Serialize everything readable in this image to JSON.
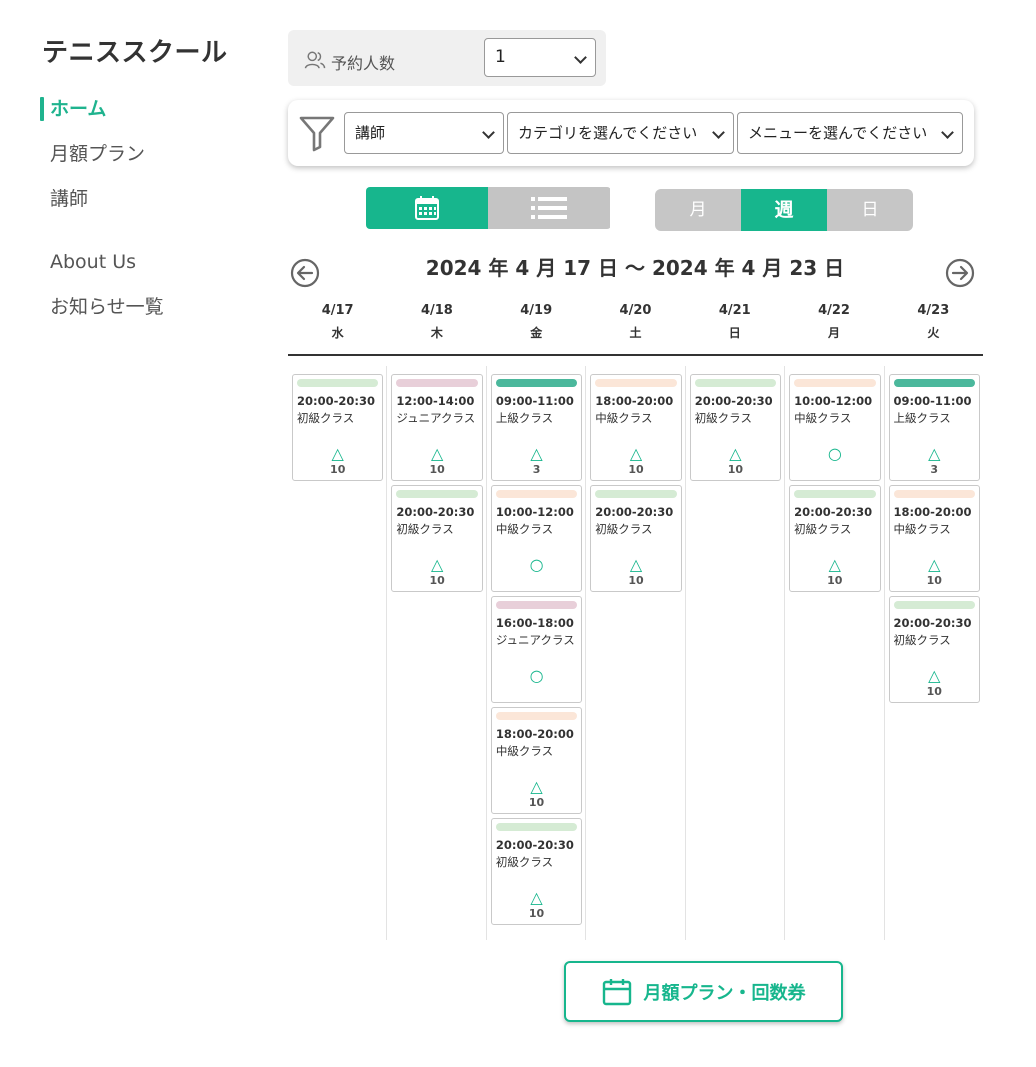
{
  "brand": "テニススクール",
  "nav": [
    {
      "label": "ホーム",
      "active": true
    },
    {
      "label": "月額プラン"
    },
    {
      "label": "講師"
    },
    {
      "label": "About Us"
    },
    {
      "label": "お知らせ一覧"
    }
  ],
  "people": {
    "label": "予約人数",
    "value": "1"
  },
  "filters": {
    "instructor": "講師",
    "category": "カテゴリを選んでください",
    "menu": "メニューを選んでください"
  },
  "view_toggle": {
    "active": "calendar"
  },
  "period": {
    "month": "月",
    "week": "週",
    "day": "日",
    "active": "week"
  },
  "week_title": "2024 年 4 月 17 日 〜 2024 年 4 月 23 日",
  "colors": {
    "accent": "#17b68d",
    "beginner": "#d5ebd4",
    "junior": "#e8cfd9",
    "advanced": "#4bb89c",
    "intermediate": "#fbe6d8"
  },
  "days": [
    {
      "date": "4/17",
      "weekday": "水",
      "slots": [
        {
          "time": "20:00-20:30",
          "class": "初級クラス",
          "level": "beginner",
          "mark": "△",
          "count": "10"
        }
      ]
    },
    {
      "date": "4/18",
      "weekday": "木",
      "slots": [
        {
          "time": "12:00-14:00",
          "class": "ジュニアクラス",
          "level": "junior",
          "mark": "△",
          "count": "10"
        },
        {
          "time": "20:00-20:30",
          "class": "初級クラス",
          "level": "beginner",
          "mark": "△",
          "count": "10"
        }
      ]
    },
    {
      "date": "4/19",
      "weekday": "金",
      "slots": [
        {
          "time": "09:00-11:00",
          "class": "上級クラス",
          "level": "advanced",
          "mark": "△",
          "count": "3"
        },
        {
          "time": "10:00-12:00",
          "class": "中級クラス",
          "level": "intermediate",
          "mark": "○",
          "count": ""
        },
        {
          "time": "16:00-18:00",
          "class": "ジュニアクラス",
          "level": "junior",
          "mark": "○",
          "count": ""
        },
        {
          "time": "18:00-20:00",
          "class": "中級クラス",
          "level": "intermediate",
          "mark": "△",
          "count": "10"
        },
        {
          "time": "20:00-20:30",
          "class": "初級クラス",
          "level": "beginner",
          "mark": "△",
          "count": "10"
        }
      ]
    },
    {
      "date": "4/20",
      "weekday": "土",
      "slots": [
        {
          "time": "18:00-20:00",
          "class": "中級クラス",
          "level": "intermediate",
          "mark": "△",
          "count": "10"
        },
        {
          "time": "20:00-20:30",
          "class": "初級クラス",
          "level": "beginner",
          "mark": "△",
          "count": "10"
        }
      ]
    },
    {
      "date": "4/21",
      "weekday": "日",
      "slots": [
        {
          "time": "20:00-20:30",
          "class": "初級クラス",
          "level": "beginner",
          "mark": "△",
          "count": "10"
        }
      ]
    },
    {
      "date": "4/22",
      "weekday": "月",
      "slots": [
        {
          "time": "10:00-12:00",
          "class": "中級クラス",
          "level": "intermediate",
          "mark": "○",
          "count": ""
        },
        {
          "time": "20:00-20:30",
          "class": "初級クラス",
          "level": "beginner",
          "mark": "△",
          "count": "10"
        }
      ]
    },
    {
      "date": "4/23",
      "weekday": "火",
      "slots": [
        {
          "time": "09:00-11:00",
          "class": "上級クラス",
          "level": "advanced",
          "mark": "△",
          "count": "3"
        },
        {
          "time": "18:00-20:00",
          "class": "中級クラス",
          "level": "intermediate",
          "mark": "△",
          "count": "10"
        },
        {
          "time": "20:00-20:30",
          "class": "初級クラス",
          "level": "beginner",
          "mark": "△",
          "count": "10"
        }
      ]
    }
  ],
  "plan_button": "月額プラン・回数券"
}
